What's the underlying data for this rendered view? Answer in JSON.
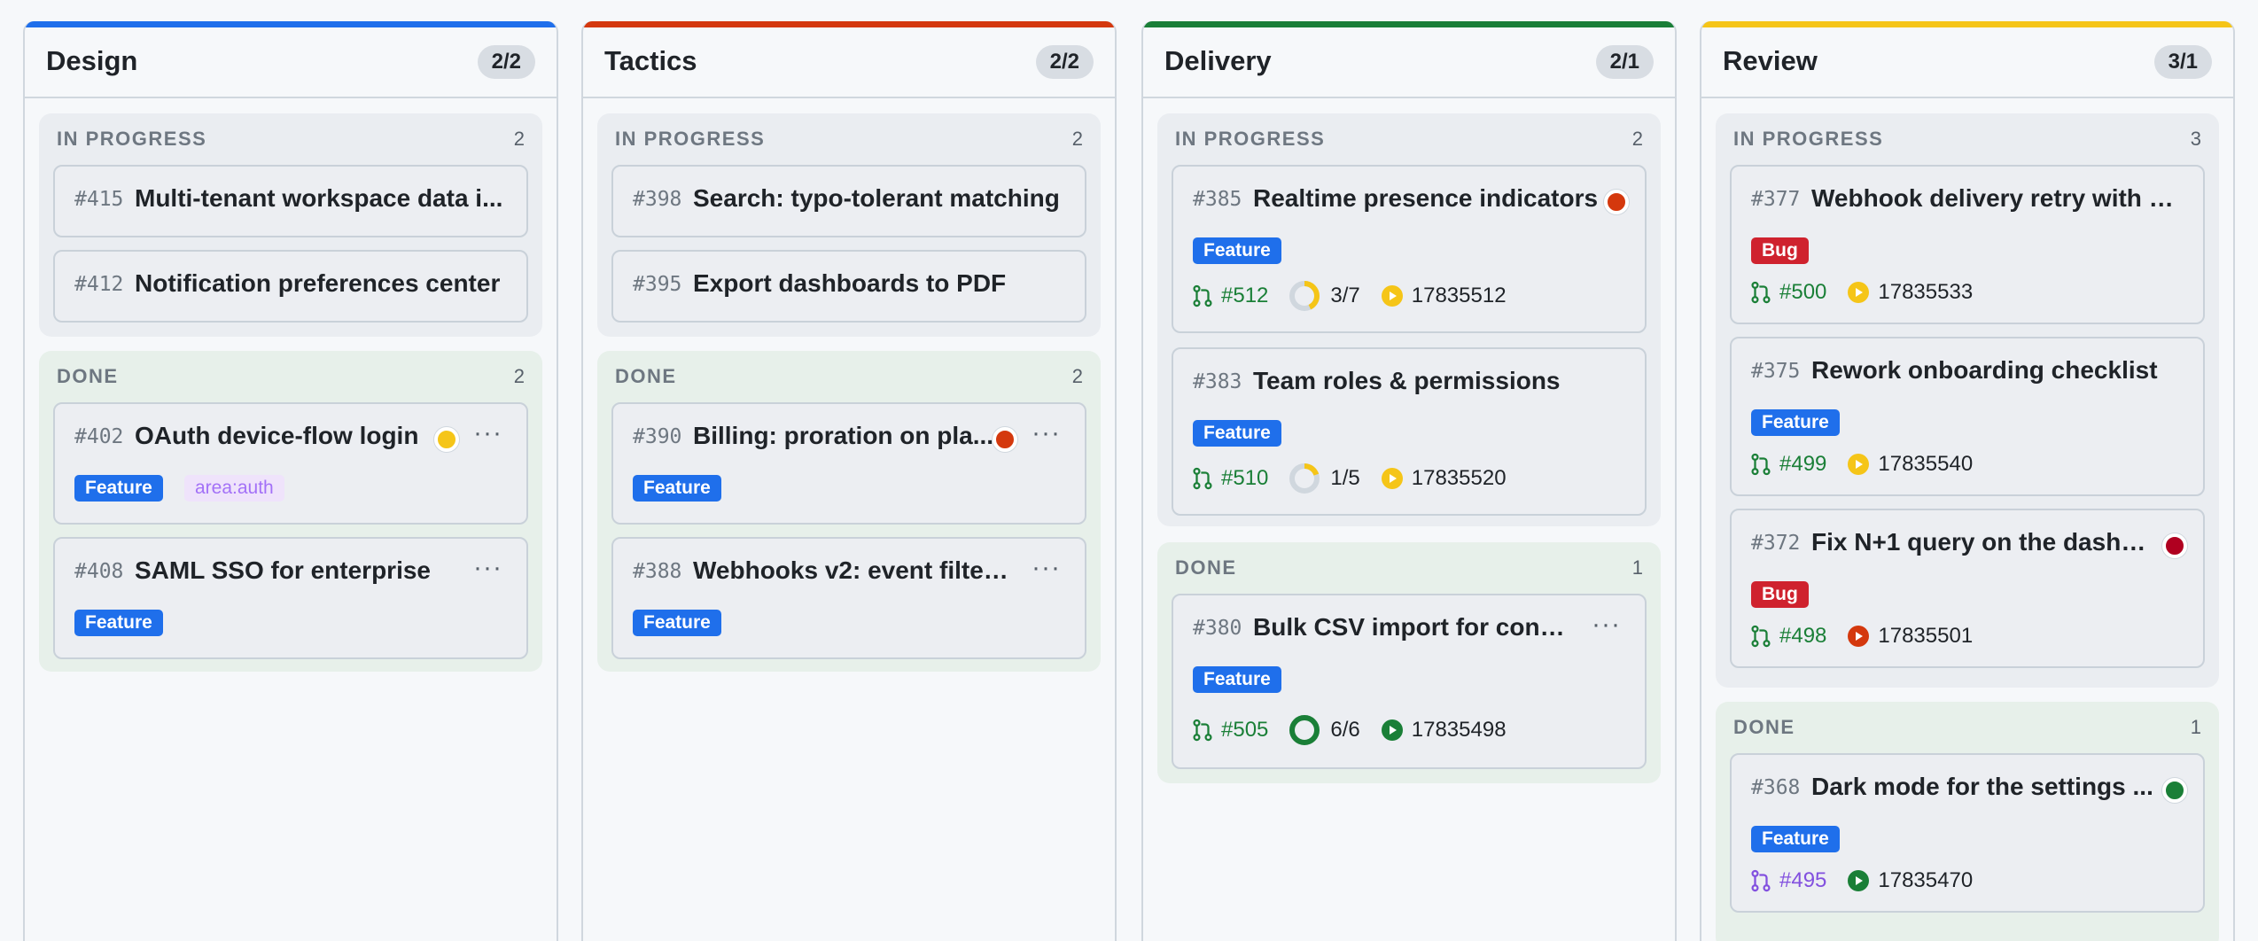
{
  "columns": [
    {
      "title": "Design",
      "count": "2/2",
      "color": "#1f6feb",
      "in_progress": {
        "label": "IN PROGRESS",
        "num": "2",
        "cards": [
          {
            "num": "#415",
            "title": "Multi-tenant workspace data i..."
          },
          {
            "num": "#412",
            "title": "Notification preferences center"
          }
        ]
      },
      "done": {
        "label": "DONE",
        "num": "2",
        "cards": [
          {
            "num": "#402",
            "title": "OAuth device-flow login",
            "status": "yellow",
            "menu": "···",
            "tags": [
              "Feature",
              "area:auth"
            ]
          },
          {
            "num": "#408",
            "title": "SAML SSO for enterprise",
            "menu": "···",
            "tags": [
              "Feature"
            ]
          }
        ]
      }
    },
    {
      "title": "Tactics",
      "count": "2/2",
      "color": "#d4380d",
      "in_progress": {
        "label": "IN PROGRESS",
        "num": "2",
        "cards": [
          {
            "num": "#398",
            "title": "Search: typo-tolerant matching"
          },
          {
            "num": "#395",
            "title": "Export dashboards to PDF"
          }
        ]
      },
      "done": {
        "label": "DONE",
        "num": "2",
        "cards": [
          {
            "num": "#390",
            "title": "Billing: proration on pla...",
            "status": "orange",
            "menu": "···",
            "tags": [
              "Feature"
            ]
          },
          {
            "num": "#388",
            "title": "Webhooks v2: event filteri...",
            "menu": "···",
            "tags": [
              "Feature"
            ]
          }
        ]
      }
    },
    {
      "title": "Delivery",
      "count": "2/1",
      "color": "#1a7f37",
      "in_progress": {
        "label": "IN PROGRESS",
        "num": "2",
        "cards": [
          {
            "num": "#385",
            "title": "Realtime presence indicators",
            "status": "orange",
            "tags": [
              "Feature"
            ],
            "pr": "#512",
            "checks": "3/7",
            "checks_frac": 0.43,
            "run": "17835512",
            "run_state": "yellow"
          },
          {
            "num": "#383",
            "title": "Team roles & permissions",
            "tags": [
              "Feature"
            ],
            "pr": "#510",
            "checks": "1/5",
            "checks_frac": 0.2,
            "run": "17835520",
            "run_state": "yellow"
          }
        ]
      },
      "done": {
        "label": "DONE",
        "num": "1",
        "cards": [
          {
            "num": "#380",
            "title": "Bulk CSV import for conta...",
            "menu": "···",
            "tags": [
              "Feature"
            ],
            "pr": "#505",
            "checks": "6/6",
            "checks_frac": 1,
            "run": "17835498",
            "run_state": "green"
          }
        ]
      }
    },
    {
      "title": "Review",
      "count": "3/1",
      "color": "#f5c518",
      "in_progress": {
        "label": "IN PROGRESS",
        "num": "3",
        "cards": [
          {
            "num": "#377",
            "title": "Webhook delivery retry with b...",
            "tags": [
              "Bug"
            ],
            "pr": "#500",
            "run": "17835533",
            "run_state": "yellow"
          },
          {
            "num": "#375",
            "title": "Rework onboarding checklist",
            "tags": [
              "Feature"
            ],
            "pr": "#499",
            "run": "17835540",
            "run_state": "yellow"
          },
          {
            "num": "#372",
            "title": "Fix N+1 query on the dashbo...",
            "status": "red",
            "tags": [
              "Bug"
            ],
            "pr": "#498",
            "run": "17835501",
            "run_state": "orange"
          }
        ]
      },
      "done": {
        "label": "DONE",
        "num": "1",
        "cards": [
          {
            "num": "#368",
            "title": "Dark mode for the settings ...",
            "status": "green",
            "tags": [
              "Feature"
            ],
            "pr": "#495",
            "pr_state": "merged",
            "run": "17835470",
            "run_state": "green"
          }
        ]
      }
    }
  ],
  "colors": {
    "yellow": "#f5c518",
    "orange": "#d4380d",
    "red": "#b00020",
    "green": "#1a7f37"
  }
}
